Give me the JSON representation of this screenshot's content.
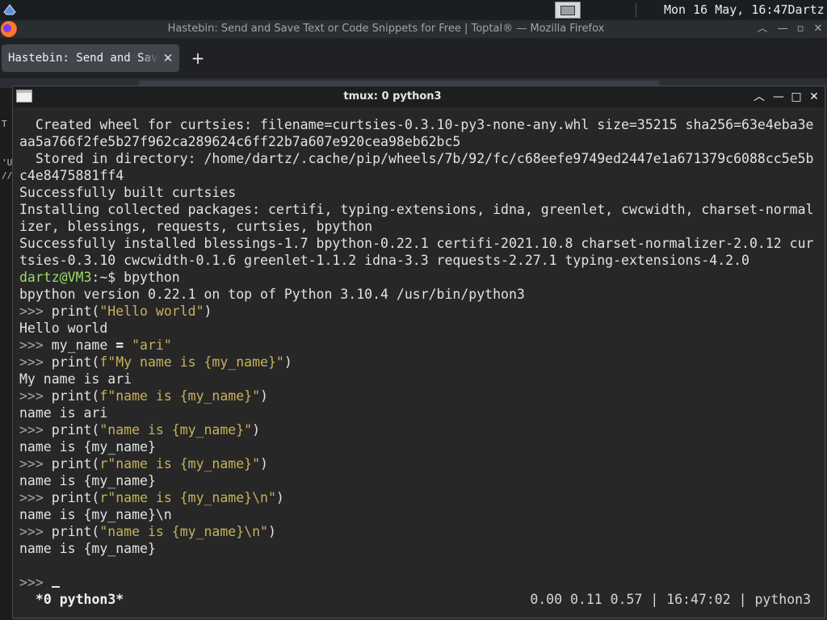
{
  "desktop": {
    "clock": "Mon 16 May, 16:47",
    "user": "Dartz"
  },
  "firefox": {
    "title": "Hastebin: Send and Save Text or Code Snippets for Free | Toptal® — Mozilla Firefox",
    "tab_label": "Hastebin: Send and Save Text or Code Snippets for Free | Toptal®",
    "tab_close": "✕",
    "new_tab": "+",
    "peek": [
      "T",
      "'U",
      "//"
    ]
  },
  "terminal": {
    "title": "tmux: 0 python3",
    "lines": [
      {
        "segs": [
          {
            "t": "  Created wheel for curtsies: filename=curtsies-0.3.10-py3-none-any.whl size=35215 sha256=63e4eba3e"
          }
        ]
      },
      {
        "segs": [
          {
            "t": "aa5a766f2fe5b27f962ca289624c6ff22b7a607e920cea98eb62bc5"
          }
        ]
      },
      {
        "segs": [
          {
            "t": "  Stored in directory: /home/dartz/.cache/pip/wheels/7b/92/fc/c68eefe9749ed2447e1a671379c6088cc5e5b"
          }
        ]
      },
      {
        "segs": [
          {
            "t": "c4e8475881ff4"
          }
        ]
      },
      {
        "segs": [
          {
            "t": "Successfully built curtsies"
          }
        ]
      },
      {
        "segs": [
          {
            "t": "Installing collected packages: certifi, typing-extensions, idna, greenlet, cwcwidth, charset-normal"
          }
        ]
      },
      {
        "segs": [
          {
            "t": "izer, blessings, requests, curtsies, bpython"
          }
        ]
      },
      {
        "segs": [
          {
            "t": "Successfully installed blessings-1.7 bpython-0.22.1 certifi-2021.10.8 charset-normalizer-2.0.12 cur"
          }
        ]
      },
      {
        "segs": [
          {
            "t": "tsies-0.3.10 cwcwidth-0.1.6 greenlet-1.1.2 idna-3.3 requests-2.27.1 typing-extensions-4.2.0"
          }
        ]
      },
      {
        "segs": [
          {
            "t": "dartz@VM3",
            "c": "g"
          },
          {
            "t": ":~$ bpython"
          }
        ]
      },
      {
        "segs": [
          {
            "t": "bpython version 0.22.1 on top of Python 3.10.4 /usr/bin/python3"
          }
        ]
      },
      {
        "segs": [
          {
            "t": ">>> ",
            "c": "p"
          },
          {
            "t": "print("
          },
          {
            "t": "\"Hello world\"",
            "c": "s"
          },
          {
            "t": ")"
          }
        ]
      },
      {
        "segs": [
          {
            "t": "Hello world"
          }
        ]
      },
      {
        "segs": [
          {
            "t": ">>> ",
            "c": "p"
          },
          {
            "t": "my_name "
          },
          {
            "t": "=",
            "c": "b"
          },
          {
            "t": " "
          },
          {
            "t": "\"ari\"",
            "c": "s"
          }
        ]
      },
      {
        "segs": [
          {
            "t": ">>> ",
            "c": "p"
          },
          {
            "t": "print("
          },
          {
            "t": "f\"My name is {my_name}\"",
            "c": "s"
          },
          {
            "t": ")"
          }
        ]
      },
      {
        "segs": [
          {
            "t": "My name is ari"
          }
        ]
      },
      {
        "segs": [
          {
            "t": ">>> ",
            "c": "p"
          },
          {
            "t": "print("
          },
          {
            "t": "f\"name is {my_name}\"",
            "c": "s"
          },
          {
            "t": ")"
          }
        ]
      },
      {
        "segs": [
          {
            "t": "name is ari"
          }
        ]
      },
      {
        "segs": [
          {
            "t": ">>> ",
            "c": "p"
          },
          {
            "t": "print("
          },
          {
            "t": "\"name is {my_name}\"",
            "c": "s"
          },
          {
            "t": ")"
          }
        ]
      },
      {
        "segs": [
          {
            "t": "name is {my_name}"
          }
        ]
      },
      {
        "segs": [
          {
            "t": ">>> ",
            "c": "p"
          },
          {
            "t": "print("
          },
          {
            "t": "r\"name is {my_name}\"",
            "c": "s"
          },
          {
            "t": ")"
          }
        ]
      },
      {
        "segs": [
          {
            "t": "name is {my_name}"
          }
        ]
      },
      {
        "segs": [
          {
            "t": ">>> ",
            "c": "p"
          },
          {
            "t": "print("
          },
          {
            "t": "r\"name is {my_name}\\n\"",
            "c": "s"
          },
          {
            "t": ")"
          }
        ]
      },
      {
        "segs": [
          {
            "t": "name is {my_name}\\n"
          }
        ]
      },
      {
        "segs": [
          {
            "t": ">>> ",
            "c": "p"
          },
          {
            "t": "print("
          },
          {
            "t": "\"name is {my_name}\\n\"",
            "c": "s"
          },
          {
            "t": ")"
          }
        ]
      },
      {
        "segs": [
          {
            "t": "name is {my_name}"
          }
        ]
      },
      {
        "segs": [
          {
            "t": ""
          }
        ]
      },
      {
        "segs": [
          {
            "t": ">>> ",
            "c": "p"
          }
        ],
        "cursor": true
      }
    ]
  },
  "tmux": {
    "window_label": " *0 python3*",
    "status_right": "0.00 0.11 0.57 | 16:47:02 | python3"
  },
  "colors": {
    "prompt_green": "#9fd96a",
    "string_yellow": "#c7b15c",
    "terminal_bg": "#272727"
  }
}
